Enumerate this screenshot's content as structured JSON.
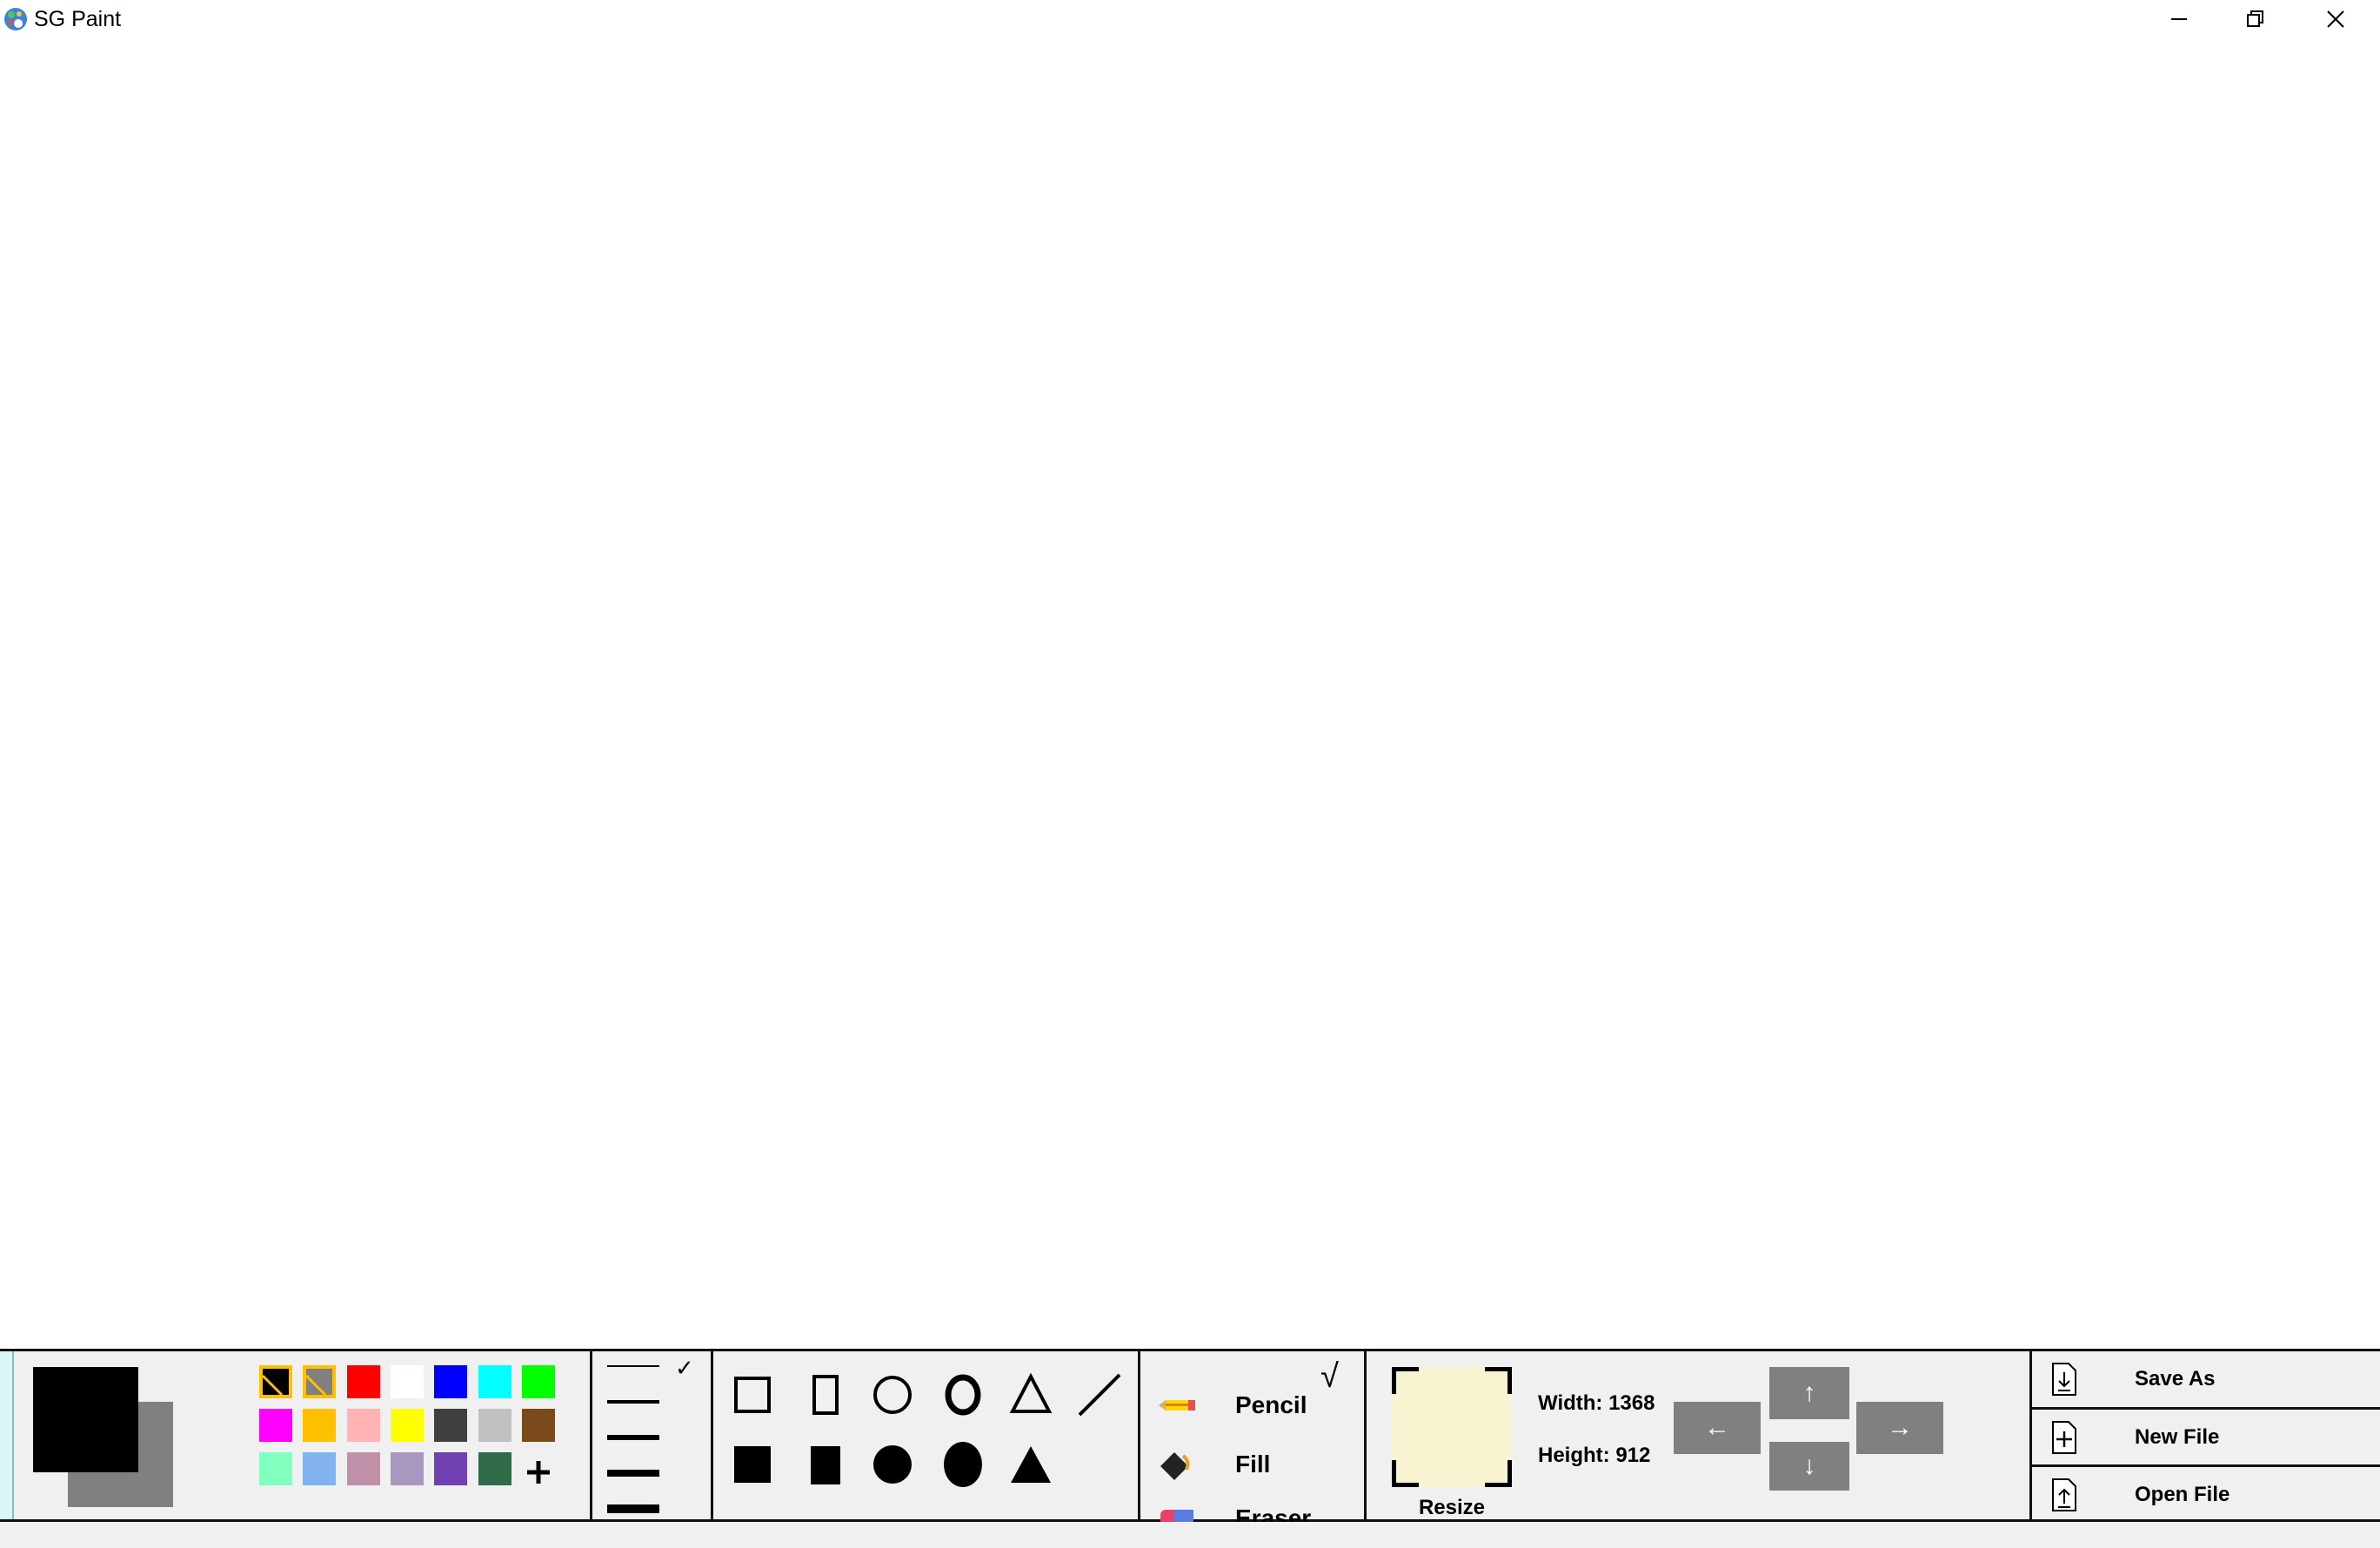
{
  "window": {
    "title": "SG Paint",
    "icon": "paint-palette-icon",
    "controls": [
      "minimize-icon",
      "restore-icon",
      "close-icon"
    ]
  },
  "colors": {
    "primary": "#000000",
    "secondary": "#808080",
    "palette": [
      "#000000",
      "#808080",
      "#ff0000",
      "#ffffff",
      "#0000ff",
      "#00ffff",
      "#00ff00",
      "#ff00ff",
      "#ffc000",
      "#ffb3b3",
      "#ffff00",
      "#404040",
      "#c0c0c0",
      "#7b4a1a",
      "#80ffbf",
      "#80b3f0",
      "#c090a8",
      "#a898c0",
      "#7040b0",
      "#2f6b48"
    ],
    "selected_accent": "#ffc000",
    "add_color_icon": "plus-icon"
  },
  "stroke": {
    "selected_mark": "✓",
    "selected_index": 0,
    "options": [
      1,
      3,
      5,
      7,
      9
    ]
  },
  "shapes": [
    "rectangle-outline-icon",
    "rounded-rectangle-outline-icon",
    "circle-outline-icon",
    "ellipse-outline-icon",
    "triangle-outline-icon",
    "line-icon",
    "rectangle-filled-icon",
    "rounded-rectangle-filled-icon",
    "circle-filled-icon",
    "ellipse-filled-icon",
    "triangle-filled-icon"
  ],
  "tools": {
    "pencil": {
      "label": "Pencil",
      "icon": "pencil-icon",
      "check": "√"
    },
    "fill": {
      "label": "Fill",
      "icon": "paint-bucket-icon"
    },
    "eraser": {
      "label": "Eraser",
      "icon": "eraser-icon"
    }
  },
  "resize": {
    "label": "Resize",
    "width_label": "Width: 1368",
    "height_label": "Height: 912",
    "preview_color": "#f8f4d2",
    "arrows": {
      "left": "←",
      "up": "↑",
      "down": "↓",
      "right": "→"
    }
  },
  "file": {
    "save_as": "Save As",
    "new_file": "New File",
    "open_file": "Open File"
  }
}
